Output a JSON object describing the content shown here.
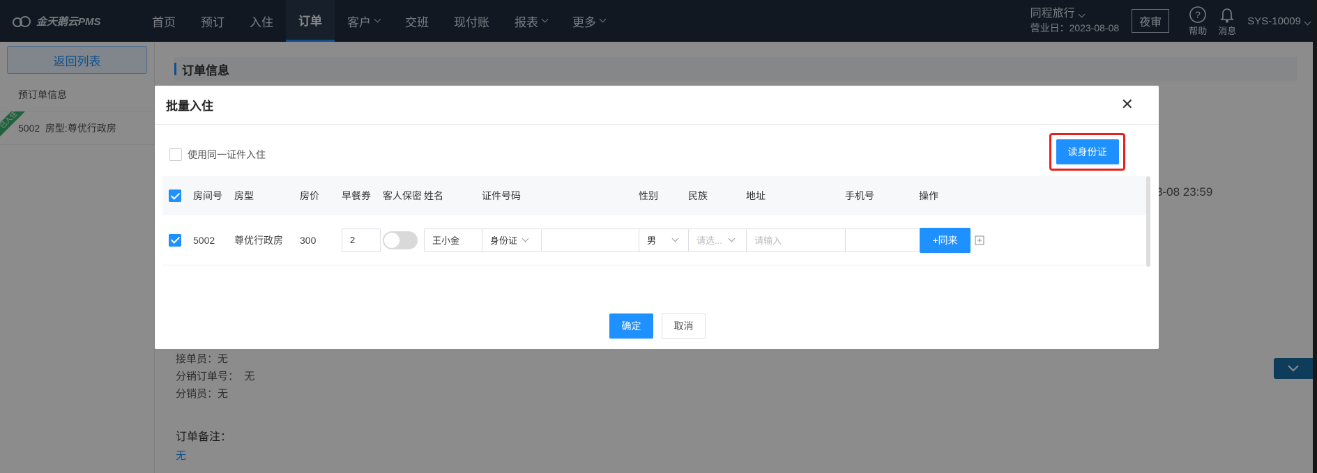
{
  "app": {
    "logo_text": "金天鹅云PMS"
  },
  "nav": {
    "items": [
      {
        "label": "首页",
        "caret": false,
        "active": false
      },
      {
        "label": "预订",
        "caret": false,
        "active": false
      },
      {
        "label": "入住",
        "caret": false,
        "active": false
      },
      {
        "label": "订单",
        "caret": false,
        "active": true
      },
      {
        "label": "客户",
        "caret": true,
        "active": false
      },
      {
        "label": "交班",
        "caret": false,
        "active": false
      },
      {
        "label": "现付账",
        "caret": false,
        "active": false
      },
      {
        "label": "报表",
        "caret": true,
        "active": false
      },
      {
        "label": "更多",
        "caret": true,
        "active": false
      }
    ]
  },
  "header_right": {
    "hotel_name": "同程旅行",
    "business_day": "营业日：2023-08-08",
    "night_audit": "夜审",
    "help": "帮助",
    "messages": "消息",
    "user": "SYS-10009"
  },
  "left_panel": {
    "back_button": "返回列表",
    "items": [
      "预订单信息",
      "5002  房型:尊优行政房"
    ],
    "ribbon": "已入住"
  },
  "main": {
    "section_title": "订单信息",
    "partial_time": "3-08 23:59",
    "info_lines": [
      "接单员：无",
      "分销订单号：  无",
      "分销员：无"
    ],
    "remark_title": "订单备注：",
    "remark_value": "无"
  },
  "modal": {
    "title": "批量入住",
    "same_id_label": "使用同一证件入住",
    "read_id_button": "读身份证",
    "columns": [
      "房间号",
      "房型",
      "房价",
      "早餐券",
      "客人保密",
      "姓名",
      "证件号码",
      "性别",
      "民族",
      "地址",
      "手机号",
      "操作"
    ],
    "row": {
      "room_no": "5002",
      "room_type": "尊优行政房",
      "price": "300",
      "breakfast": "2",
      "privacy_on": false,
      "name": "王小金",
      "id_type": "身份证",
      "id_number": "",
      "gender": "男",
      "ethnicity_placeholder": "请选...",
      "address_placeholder": "请输入",
      "phone": "",
      "add_companion": "+同来"
    },
    "confirm": "确定",
    "cancel": "取消"
  },
  "colors": {
    "primary": "#1e90ff",
    "topbar": "#1f2d3d",
    "highlight": "#e8201c"
  }
}
